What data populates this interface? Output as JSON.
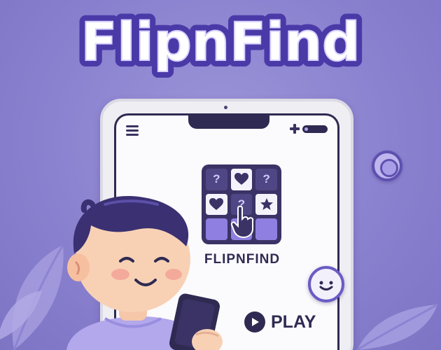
{
  "hero": {
    "title": "FlipnFind"
  },
  "phone": {
    "app_name": "FLIPNFIND",
    "play_label": "PLAY",
    "grid_tiles": [
      {
        "kind": "question",
        "text": "?"
      },
      {
        "kind": "heart",
        "text": ""
      },
      {
        "kind": "question",
        "text": "?"
      },
      {
        "kind": "heart",
        "text": ""
      },
      {
        "kind": "question",
        "text": "?"
      },
      {
        "kind": "star",
        "text": ""
      },
      {
        "kind": "blank",
        "text": ""
      },
      {
        "kind": "blank",
        "text": ""
      },
      {
        "kind": "blank",
        "text": ""
      }
    ]
  },
  "icons": [
    "menu-icon",
    "plus-icon",
    "play-icon",
    "smiley-icon",
    "ring-icon",
    "heart-icon",
    "star-icon",
    "hand-pointer-icon"
  ],
  "colors": {
    "background": "#8a82cf",
    "title_fill": "#ffffff",
    "title_outline": "#4a3aa8",
    "dark_ink": "#2f2a52",
    "accent": "#8e7fe0"
  }
}
